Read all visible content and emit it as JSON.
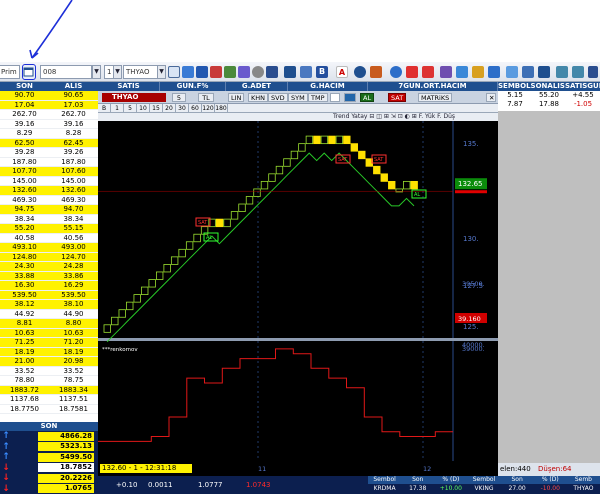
{
  "toolbar": {
    "mode_label": "Prim",
    "layout_value": "008",
    "period_value": "1",
    "symbol_value": "THYAO"
  },
  "left_table": {
    "headers": [
      "SON",
      "ALIS"
    ],
    "rows": [
      {
        "son": "90.70",
        "alis": "90.65",
        "hl": true
      },
      {
        "son": "17.04",
        "alis": "17.03",
        "hl": true
      },
      {
        "son": "262.70",
        "alis": "262.70",
        "hl": false
      },
      {
        "son": "39.16",
        "alis": "39.16",
        "hl": false
      },
      {
        "son": "8.29",
        "alis": "8.28",
        "hl": false
      },
      {
        "son": "62.50",
        "alis": "62.45",
        "hl": true
      },
      {
        "son": "39.28",
        "alis": "39.26",
        "hl": false
      },
      {
        "son": "187.80",
        "alis": "187.80",
        "hl": false
      },
      {
        "son": "107.70",
        "alis": "107.60",
        "hl": true
      },
      {
        "son": "145.00",
        "alis": "145.00",
        "hl": false
      },
      {
        "son": "132.60",
        "alis": "132.60",
        "hl": true
      },
      {
        "son": "469.30",
        "alis": "469.30",
        "hl": false
      },
      {
        "son": "94.75",
        "alis": "94.70",
        "hl": true
      },
      {
        "son": "38.34",
        "alis": "38.34",
        "hl": false
      },
      {
        "son": "55.20",
        "alis": "55.15",
        "hl": true
      },
      {
        "son": "40.58",
        "alis": "40.56",
        "hl": false
      },
      {
        "son": "493.10",
        "alis": "493.00",
        "hl": true
      },
      {
        "son": "124.80",
        "alis": "124.70",
        "hl": true
      },
      {
        "son": "24.30",
        "alis": "24.28",
        "hl": true
      },
      {
        "son": "33.88",
        "alis": "33.86",
        "hl": true
      },
      {
        "son": "16.30",
        "alis": "16.29",
        "hl": true
      },
      {
        "son": "539.50",
        "alis": "539.50",
        "hl": true
      },
      {
        "son": "38.12",
        "alis": "38.10",
        "hl": true
      },
      {
        "son": "44.92",
        "alis": "44.90",
        "hl": false
      },
      {
        "son": "8.81",
        "alis": "8.80",
        "hl": true
      },
      {
        "son": "10.63",
        "alis": "10.63",
        "hl": true
      },
      {
        "son": "71.25",
        "alis": "71.20",
        "hl": true
      },
      {
        "son": "18.19",
        "alis": "18.19",
        "hl": true
      },
      {
        "son": "21.00",
        "alis": "20.98",
        "hl": true
      },
      {
        "son": "33.52",
        "alis": "33.52",
        "hl": false
      },
      {
        "son": "78.80",
        "alis": "78.75",
        "hl": false
      },
      {
        "son": "1883.72",
        "alis": "1883.34",
        "hl": true
      },
      {
        "son": "1137.68",
        "alis": "1137.51",
        "hl": false
      },
      {
        "son": "18.7750",
        "alis": "18.7581",
        "hl": false
      }
    ]
  },
  "son_panel": {
    "header": "SON",
    "rows": [
      {
        "dir": "up",
        "val": "4866.28",
        "style": "y"
      },
      {
        "dir": "up",
        "val": "5323.13",
        "style": "y"
      },
      {
        "dir": "up",
        "val": "5499.50",
        "style": "y"
      },
      {
        "dir": "dn",
        "val": "18.7852",
        "style": "w"
      },
      {
        "dir": "dn",
        "val": "20.2226",
        "style": "y"
      },
      {
        "dir": "dn",
        "val": "1.0765",
        "style": "y"
      }
    ]
  },
  "mid_header": [
    "SATIS",
    "GUN.F%",
    "G.ADET",
    "G.HACIM",
    "7GUN.ORT.HACIM"
  ],
  "chart_window": {
    "symbol": "THYAO",
    "period": "5",
    "currency": "TL",
    "scale_buttons": [
      "LIN",
      "KHN",
      "SVD",
      "SYM",
      "TMP"
    ],
    "al_label": "AL",
    "sat_label": "SAT",
    "matriks_label": "MATRiKS",
    "periods": [
      "B",
      "1",
      "5",
      "10",
      "15",
      "20",
      "30",
      "60",
      "120",
      "180"
    ],
    "status": "132.60 - 1 - 12:31:18",
    "axis_labels": [
      "135.",
      "132.5",
      "130.",
      "127.5",
      "125."
    ],
    "current_price": "132.65",
    "indicator_axis": [
      "40000.",
      "39500.",
      "39.160",
      "39000."
    ],
    "indicator_name": "***renkomov",
    "signal_sat": "SAT",
    "signal_al": "AL",
    "x_ticks": [
      "11",
      "12"
    ]
  },
  "chart_data": {
    "type": "line",
    "title": "",
    "series": [
      {
        "name": "",
        "values": [
          125.2,
          125.6,
          126.0,
          126.4,
          126.8,
          127.2,
          127.6,
          128.0,
          128.4,
          128.8,
          129.2,
          129.6,
          130.0,
          130.4,
          130.8,
          130.4,
          130.8,
          131.2,
          131.6,
          132.0,
          132.4,
          132.8,
          133.2,
          133.6,
          134.0,
          134.4,
          134.8,
          135.2,
          134.8,
          135.2,
          134.8,
          135.2,
          134.8,
          134.4,
          134.0,
          133.6,
          133.2,
          132.8,
          132.4,
          132.4,
          132.8,
          132.4
        ]
      },
      {
        "name": "",
        "values": [
          39050,
          39050,
          39050,
          39100,
          39300,
          39700,
          39650,
          39800,
          39900,
          39900,
          40000,
          39950,
          39800,
          39700,
          39600,
          39300,
          39150,
          39100,
          39100,
          39150
        ]
      }
    ]
  },
  "right_panel": {
    "headers": [
      "SEMBOL",
      "SON",
      "ALIS",
      "SATIS",
      "GUN.F%"
    ],
    "rows": [
      {
        "a": "5.15",
        "b": "55.20",
        "c": "+4.55",
        "neg": false
      },
      {
        "a": "7.87",
        "b": "17.88",
        "c": "-1.05",
        "neg": true
      }
    ],
    "status_a": "elen:440",
    "status_b": "Düşen:64"
  },
  "bottom_status": {
    "a": "+0.10",
    "b": "0.0011",
    "c": "1.0777",
    "d": "1.0743"
  },
  "bottom_table": {
    "headers": [
      "Sembol",
      "Son",
      "% (D)",
      "Sembol",
      "Son",
      "% (D)",
      "Semb"
    ],
    "row": [
      "KRDMA",
      "17.38",
      "+10.00",
      "VKING",
      "27.00",
      "-10.00",
      "THYAO"
    ]
  }
}
